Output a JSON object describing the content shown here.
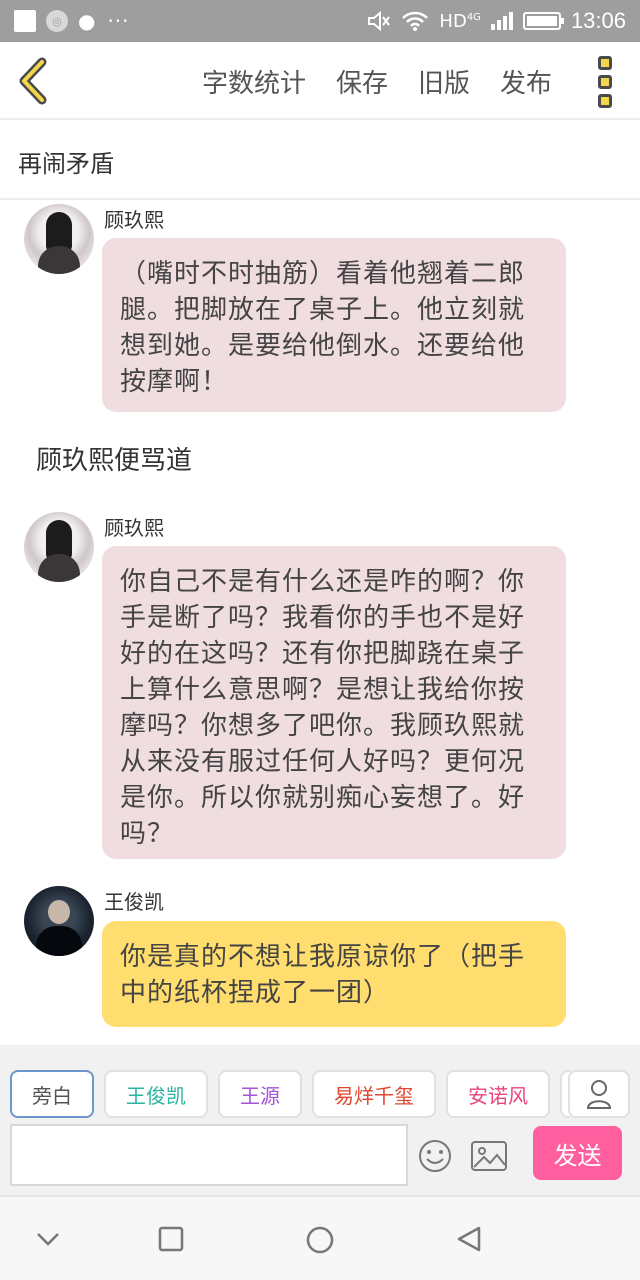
{
  "status_bar": {
    "network": "HD",
    "network_type": "4G",
    "time": "13:06",
    "icons": [
      "screenshot-icon",
      "search-icon",
      "wechat-icon",
      "more-icon",
      "mute-icon",
      "wifi-icon",
      "signal-icon",
      "battery-icon"
    ]
  },
  "toolbar": {
    "actions": [
      "字数统计",
      "保存",
      "旧版",
      "发布"
    ],
    "icons": [
      "back-icon",
      "menu-icon"
    ],
    "accent": "#f4d64e"
  },
  "document": {
    "title": "再闹矛盾"
  },
  "messages": [
    {
      "speaker": "顾玖熙",
      "text": "（嘴时不时抽筋）看着他翘着二郎腿。把脚放在了桌子上。他立刻就想到她。是要给他倒水。还要给他按摩啊！",
      "bubble_color": "#f0dde0"
    },
    {
      "narration": "顾玖熙便骂道"
    },
    {
      "speaker": "顾玖熙",
      "text": "你自己不是有什么还是咋的啊？你手是断了吗？我看你的手也不是好好的在这吗？还有你把脚跷在桌子上算什么意思啊？是想让我给你按摩吗？你想多了吧你。我顾玖熙就从来没有服过任何人好吗？更何况是你。所以你就别痴心妄想了。好吗？",
      "bubble_color": "#f0dde0"
    },
    {
      "speaker": "王俊凯",
      "text": "你是真的不想让我原谅你了（把手中的纸杯捏成了一团）",
      "bubble_color": "#ffdd6e"
    }
  ],
  "roles": [
    {
      "label": "旁白",
      "color": "#555555"
    },
    {
      "label": "王俊凯",
      "color": "#2bb3a0"
    },
    {
      "label": "王源",
      "color": "#a355d6"
    },
    {
      "label": "易烊千玺",
      "color": "#e2452f"
    },
    {
      "label": "安诺风",
      "color": "#e8467c"
    }
  ],
  "composer": {
    "placeholder": "",
    "send_label": "发送",
    "send_color": "#ff5f9e",
    "icons": [
      "person-icon",
      "emoji-icon",
      "image-icon"
    ]
  },
  "nav_bar": {
    "icons": [
      "chevron-down-icon",
      "recents-icon",
      "home-icon",
      "back-triangle-icon"
    ]
  }
}
